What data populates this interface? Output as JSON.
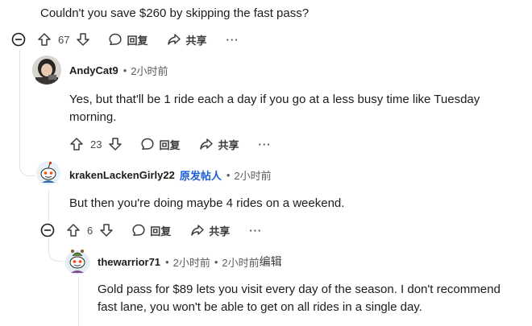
{
  "comments": [
    {
      "body": "Couldn't you save $260 by skipping the fast pass?",
      "votes": "67",
      "reply_label": "回复",
      "share_label": "共享",
      "more": "···"
    },
    {
      "author": "AndyCat9",
      "sep": "•",
      "time": "2小时前",
      "body_lines": [
        "Yes, but that'll be 1 ride each a day if you go at a less busy time like Tuesday",
        "morning."
      ],
      "votes": "23",
      "reply_label": "回复",
      "share_label": "共享",
      "more": "···"
    },
    {
      "author": "krakenLackenGirly22",
      "op_label": "原发帖人",
      "sep": "•",
      "time": "2小时前",
      "body": "But then you're doing maybe 4 rides on a weekend.",
      "votes": "6",
      "reply_label": "回复",
      "share_label": "共享",
      "more": "···"
    },
    {
      "author": "thewarrior71",
      "sep": "•",
      "time": "2小时前",
      "sep2": "•",
      "edited_time": "2小时前",
      "edited_label": "编辑",
      "body_lines": [
        "Gold pass for $89 lets you visit every day of the season. I don't recommend",
        "fast lane, you won't be able to get on all rides in a single day."
      ]
    }
  ],
  "icons": {
    "collapse": "collapse-icon",
    "upvote": "upvote-icon",
    "downvote": "downvote-icon",
    "reply": "reply-icon",
    "share": "share-icon"
  }
}
